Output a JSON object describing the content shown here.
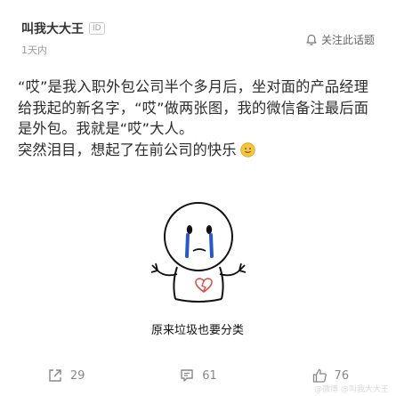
{
  "post": {
    "author": "叫我大大王",
    "id_badge": "ID",
    "time": "1天内",
    "follow_label": "关注此话题",
    "paragraphs": [
      "“哎”是我入职外包公司半个多月后，坐对面的产品经理给我起的新名字，“哎”做两张图，我的微信备注最后面是外包。我就是“哎”大人。",
      "突然泪目，想起了在前公司的快乐"
    ],
    "emoji_icon": "slight-smile-emoji",
    "image": {
      "caption": "原来垃圾也要分类",
      "icon": "crying-stick-figure-with-broken-heart"
    }
  },
  "actions": {
    "share_icon": "share-icon",
    "share_count": "29",
    "comment_icon": "comment-icon",
    "comment_count": "61",
    "like_icon": "thumbs-up-icon",
    "like_count": "76"
  },
  "watermark": "@微博 @叫我大大王",
  "colors": {
    "tears": "#2a58c9",
    "heart": "#d9534f",
    "emoji": "#f5c542"
  }
}
